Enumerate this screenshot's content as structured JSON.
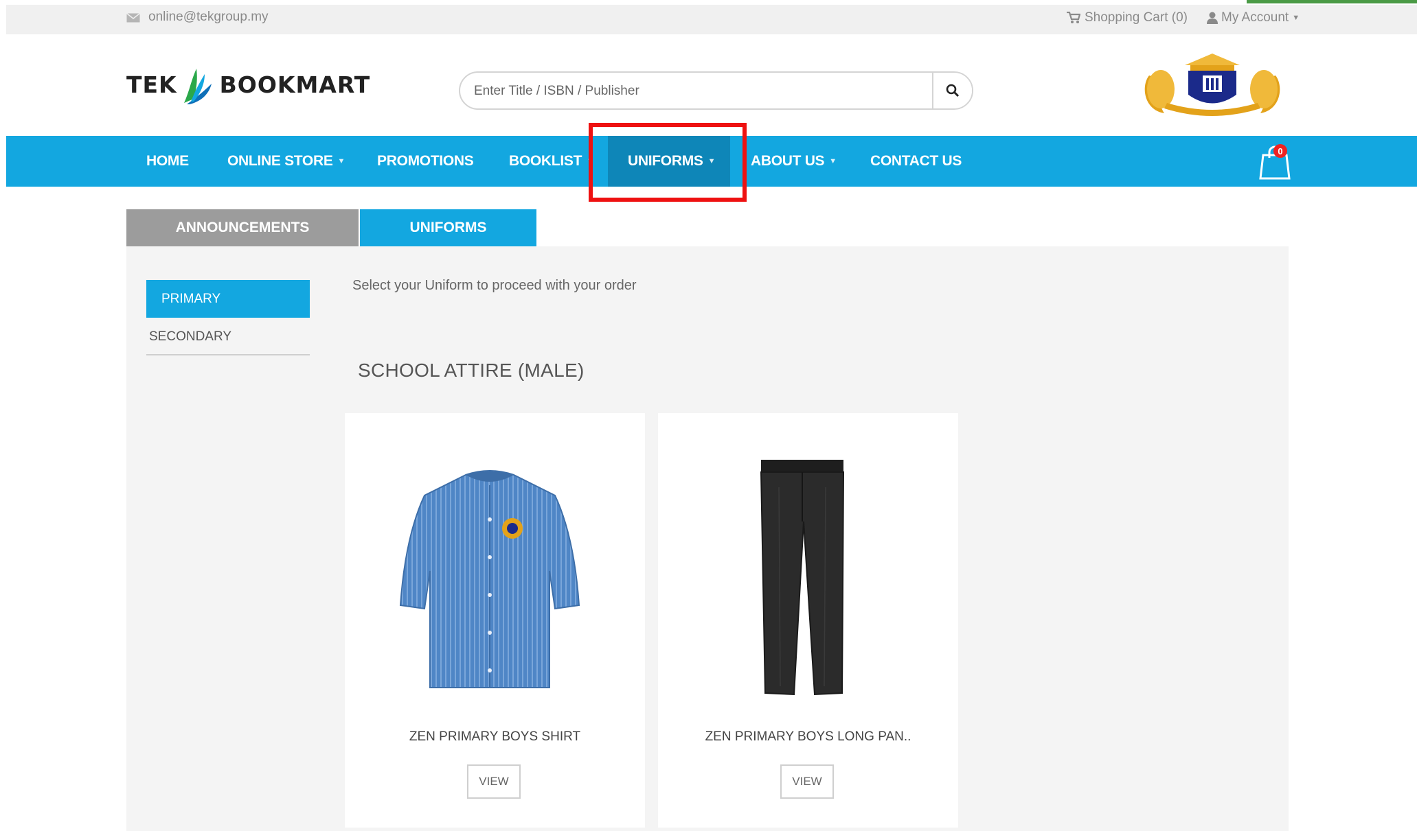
{
  "topbar": {
    "email": "online@tekgroup.my",
    "email_icon": "envelope-icon",
    "cart_label": "Shopping Cart (0)",
    "cart_icon": "cart-icon",
    "account_label": "My Account",
    "account_icon": "user-icon"
  },
  "header": {
    "logo_text_left": "TEK",
    "logo_text_right": "BOOKMART",
    "search_placeholder": "Enter Title / ISBN / Publisher",
    "search_icon": "search-icon",
    "crest_icon": "school-crest-icon"
  },
  "nav": {
    "items": [
      {
        "label": "HOME",
        "dropdown": false
      },
      {
        "label": "ONLINE STORE",
        "dropdown": true
      },
      {
        "label": "PROMOTIONS",
        "dropdown": false
      },
      {
        "label": "BOOKLIST",
        "dropdown": true
      },
      {
        "label": "UNIFORMS",
        "dropdown": true,
        "active": true
      },
      {
        "label": "ABOUT US",
        "dropdown": true
      },
      {
        "label": "CONTACT US",
        "dropdown": false
      }
    ],
    "bag_count": "0",
    "bag_icon": "shopping-bag-icon"
  },
  "tabs": [
    {
      "label": "ANNOUNCEMENTS"
    },
    {
      "label": "UNIFORMS",
      "active": true
    }
  ],
  "sidebar": {
    "items": [
      {
        "label": "PRIMARY",
        "active": true
      },
      {
        "label": "SECONDARY"
      }
    ]
  },
  "main": {
    "instruction": "Select your Uniform to proceed with your order",
    "section_title": "SCHOOL ATTIRE (MALE)",
    "products": [
      {
        "name": "ZEN PRIMARY BOYS SHIRT",
        "button": "VIEW",
        "image_icon": "shirt-icon"
      },
      {
        "name": "ZEN PRIMARY BOYS LONG PAN..",
        "button": "VIEW",
        "image_icon": "trousers-icon"
      }
    ]
  },
  "colors": {
    "brand_blue": "#13a7e0",
    "active_nav": "#0e86b8",
    "highlight_red": "#ee1111"
  }
}
